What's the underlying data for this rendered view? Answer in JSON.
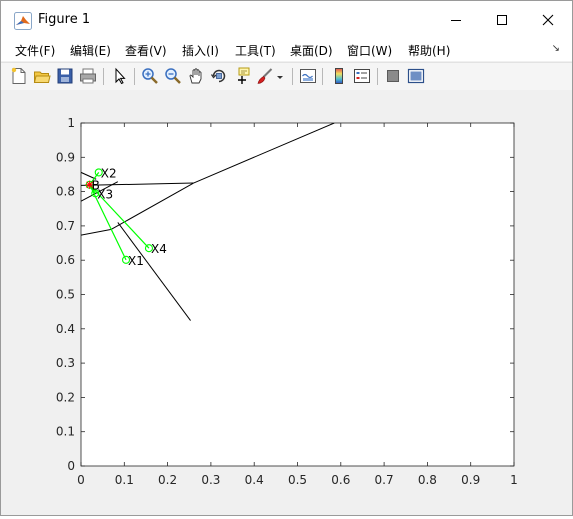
{
  "window": {
    "title": "Figure 1",
    "controls": [
      "minimize",
      "maximize",
      "close"
    ]
  },
  "menu": {
    "items": [
      "文件(F)",
      "编辑(E)",
      "查看(V)",
      "插入(I)",
      "工具(T)",
      "桌面(D)",
      "窗口(W)",
      "帮助(H)"
    ]
  },
  "toolbar": {
    "icons": [
      "new-figure-icon",
      "open-file-icon",
      "save-icon",
      "print-icon",
      "edit-plot-arrow-icon",
      "zoom-in-icon",
      "zoom-out-icon",
      "pan-hand-icon",
      "rotate-3d-icon",
      "data-cursor-icon",
      "brush-icon",
      "brush-dropdown-icon",
      "link-plot-icon",
      "colorbar-icon",
      "legend-icon",
      "hide-plot-tools-icon",
      "show-plot-tools-icon"
    ]
  },
  "colors": {
    "edges": "#000000",
    "links": "#00ff00",
    "marker": "#ff0000",
    "axes_bg": "#ffffff",
    "figure_bg": "#f0f0f0"
  },
  "chart_data": {
    "type": "scatter",
    "title": "",
    "xlabel": "",
    "ylabel": "",
    "xlim": [
      0,
      1
    ],
    "ylim": [
      0,
      1
    ],
    "xticks": [
      "0",
      "0.1",
      "0.2",
      "0.3",
      "0.4",
      "0.5",
      "0.6",
      "0.7",
      "0.8",
      "0.9",
      "1"
    ],
    "yticks": [
      "0",
      "0.1",
      "0.2",
      "0.3",
      "0.4",
      "0.5",
      "0.6",
      "0.7",
      "0.8",
      "0.9",
      "1"
    ],
    "grid": false,
    "points": [
      {
        "label": "X1",
        "x": 0.104,
        "y": 0.601
      },
      {
        "label": "X2",
        "x": 0.041,
        "y": 0.856
      },
      {
        "label": "X3",
        "x": 0.033,
        "y": 0.795
      },
      {
        "label": "X4",
        "x": 0.157,
        "y": 0.635
      }
    ],
    "center": {
      "label": "B",
      "x": 0.02,
      "y": 0.82
    },
    "edges": [
      [
        [
          0.0,
          0.772
        ],
        [
          0.085,
          0.829
        ]
      ],
      [
        [
          0.0,
          0.856
        ],
        [
          0.035,
          0.836
        ]
      ],
      [
        [
          0.0,
          0.818
        ],
        [
          0.26,
          0.825
        ]
      ],
      [
        [
          0.26,
          0.825
        ],
        [
          0.585,
          1.0
        ]
      ],
      [
        [
          0.0,
          0.673
        ],
        [
          0.07,
          0.69
        ]
      ],
      [
        [
          0.07,
          0.69
        ],
        [
          0.26,
          0.825
        ]
      ],
      [
        [
          0.085,
          0.71
        ],
        [
          0.253,
          0.424
        ]
      ]
    ]
  }
}
